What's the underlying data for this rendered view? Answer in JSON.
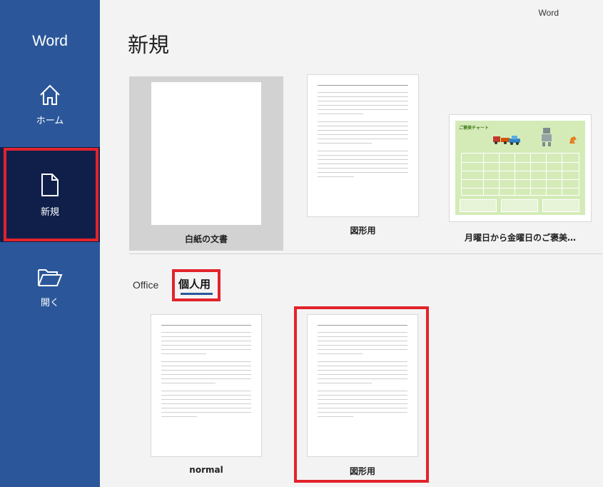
{
  "app": {
    "name": "Word",
    "top_label": "Word"
  },
  "sidebar": {
    "items": [
      {
        "label": "ホーム",
        "icon": "home-icon"
      },
      {
        "label": "新規",
        "icon": "new-document-icon",
        "selected": true
      },
      {
        "label": "開く",
        "icon": "open-folder-icon"
      }
    ]
  },
  "main": {
    "title": "新規",
    "featured": [
      {
        "label": "白紙の文書"
      },
      {
        "label": "図形用"
      },
      {
        "label": "月曜日から金曜日のご褒美…",
        "thumb_title": "ご褒美チャート"
      }
    ],
    "tabs": [
      {
        "label": "Office"
      },
      {
        "label": "個人用",
        "selected": true
      }
    ],
    "personal_templates": [
      {
        "label": "normal"
      },
      {
        "label": "図形用"
      }
    ]
  },
  "colors": {
    "sidebar": "#2b579a",
    "selected": "#0f1f4a",
    "highlight": "#e2232b",
    "chart_bg": "#d4ebb8"
  }
}
